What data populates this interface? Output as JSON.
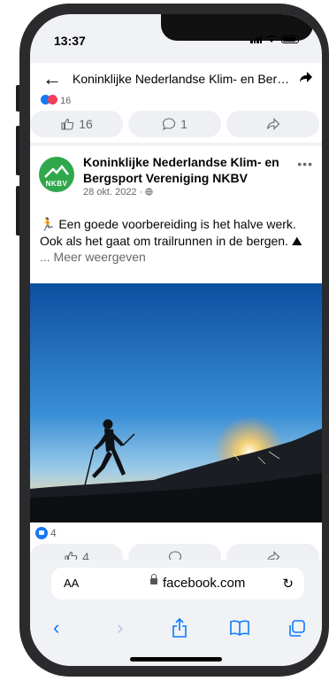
{
  "status": {
    "time": "13:37"
  },
  "appbar": {
    "title": "Koninklijke Nederlandse Klim- en Berg..."
  },
  "prev_post": {
    "reaction_count": "16",
    "likes": "16",
    "comments": "1"
  },
  "post": {
    "avatar_text": "NKBV",
    "page_name": "Koninklijke Nederlandse Klim- en Bergsport Vereniging NKBV",
    "date": "28 okt. 2022 ·",
    "text": "🏃 Een goede voorbereiding is het halve werk. Ook als het gaat om trailrunnen in de bergen. ⛰",
    "see_more": "... Meer weergeven",
    "reaction_count": "4",
    "likes": "4",
    "more_icon": "ellipsis-icon"
  },
  "browser": {
    "aa": "AA",
    "url": "facebook.com"
  },
  "colors": {
    "accent": "#1877f2",
    "safari_blue": "#0a7aff",
    "brand_green": "#2ea84a"
  }
}
